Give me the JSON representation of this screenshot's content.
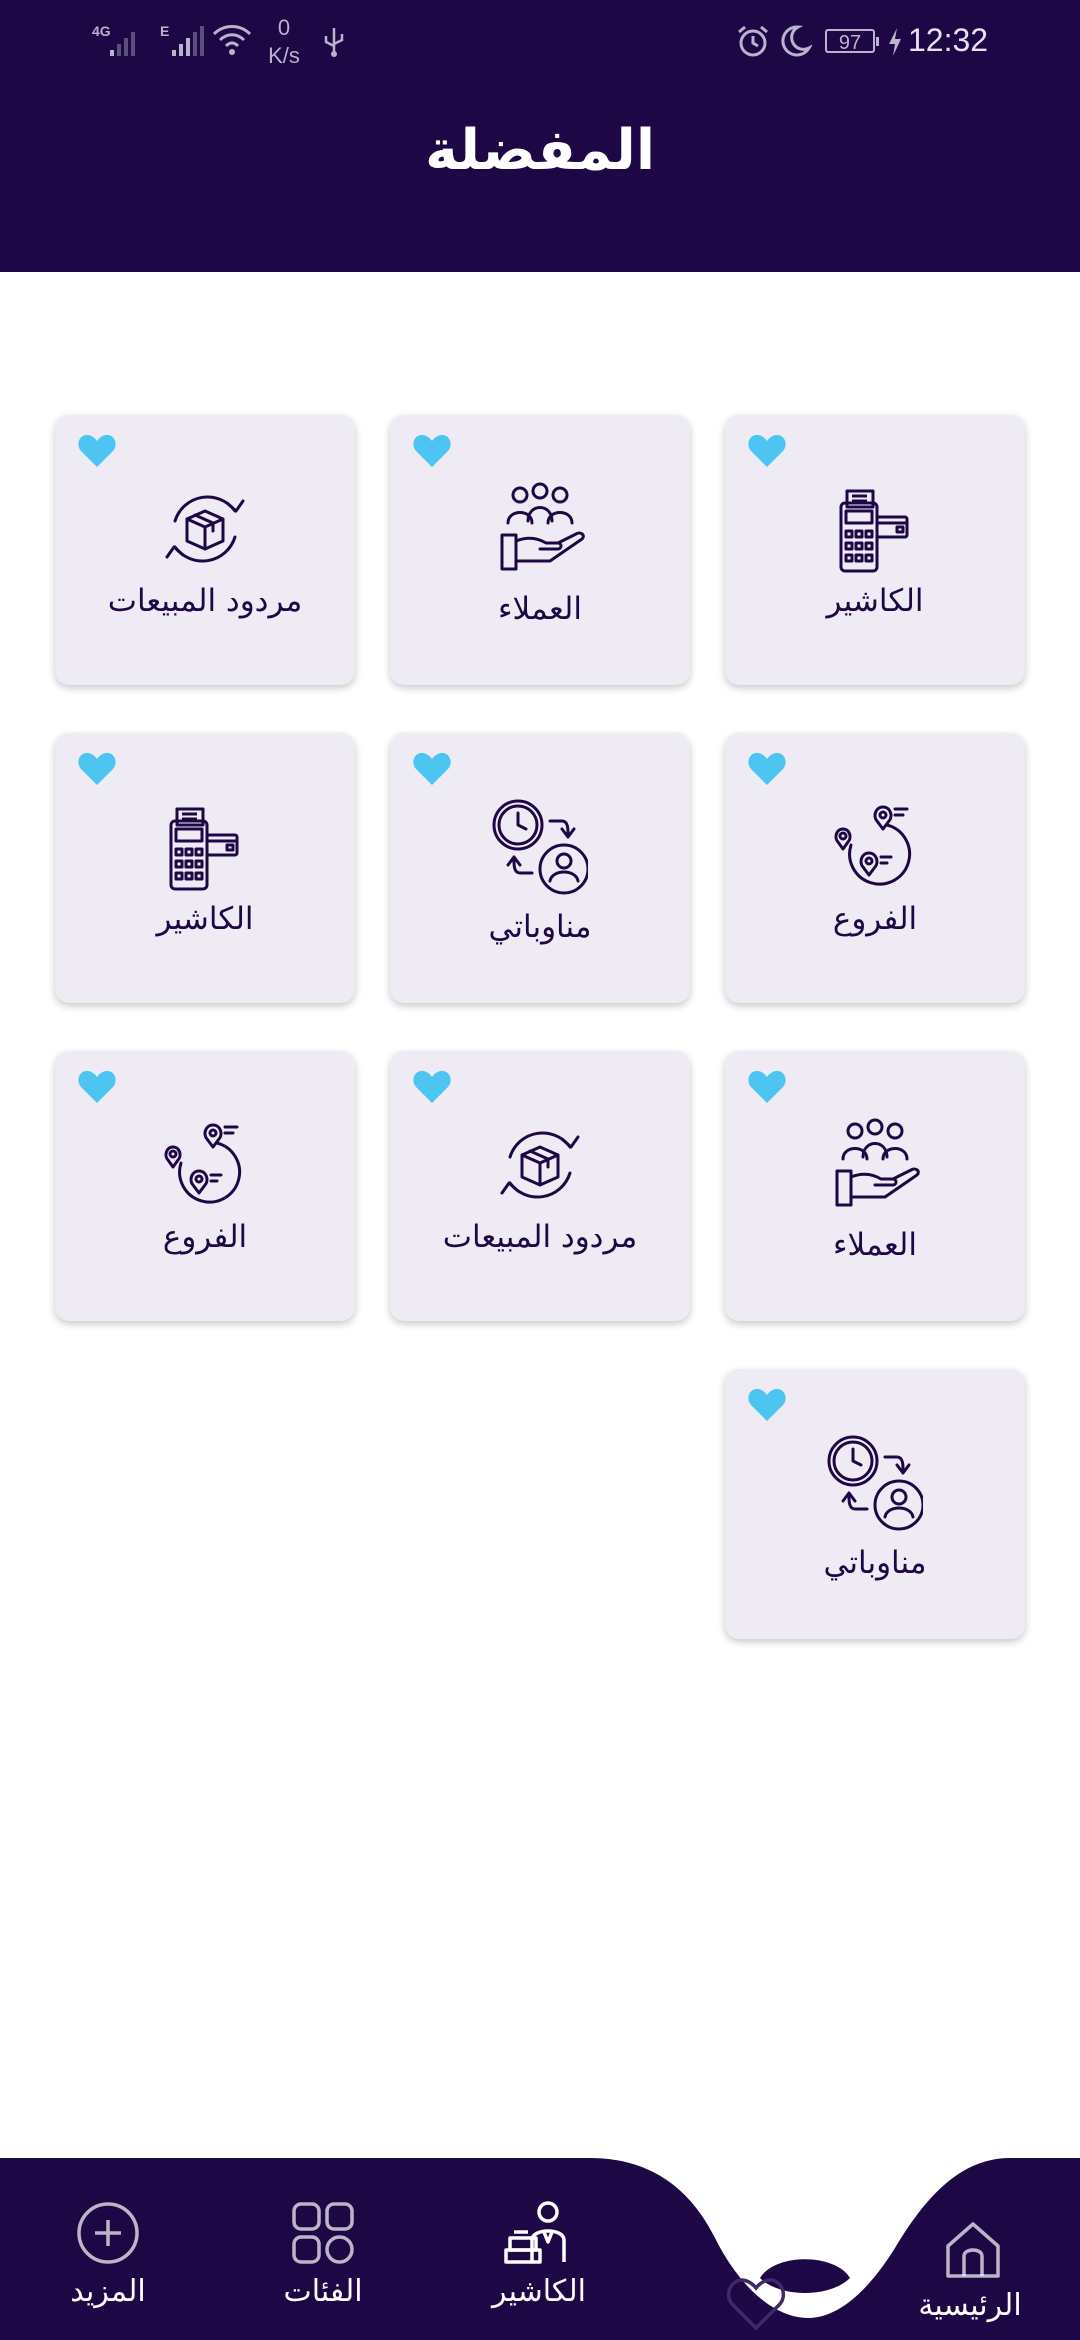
{
  "status_bar": {
    "network_1": "4G",
    "network_2": "E",
    "speed_value": "0",
    "speed_unit": "K/s",
    "battery": "97",
    "time": "12:32"
  },
  "page": {
    "title": "المفضلة"
  },
  "colors": {
    "primary": "#1e0745",
    "card_bg": "#efebf5",
    "heart": "#4cc6f0"
  },
  "favorites": [
    {
      "label": "الكاشير",
      "icon": "cashier-register-icon"
    },
    {
      "label": "العملاء",
      "icon": "customers-hand-icon"
    },
    {
      "label": "مردود المبيعات",
      "icon": "sales-return-box-icon"
    },
    {
      "label": "الفروع",
      "icon": "branches-location-icon"
    },
    {
      "label": "مناوباتي",
      "icon": "shifts-clock-user-icon"
    },
    {
      "label": "الكاشير",
      "icon": "cashier-register-icon"
    },
    {
      "label": "العملاء",
      "icon": "customers-hand-icon"
    },
    {
      "label": "مردود المبيعات",
      "icon": "sales-return-box-icon"
    },
    {
      "label": "الفروع",
      "icon": "branches-location-icon"
    },
    {
      "label": "مناوباتي",
      "icon": "shifts-clock-user-icon"
    }
  ],
  "bottom_nav": {
    "home": "الرئيسية",
    "cashier": "الكاشير",
    "categories": "الفئات",
    "more": "المزيد"
  }
}
